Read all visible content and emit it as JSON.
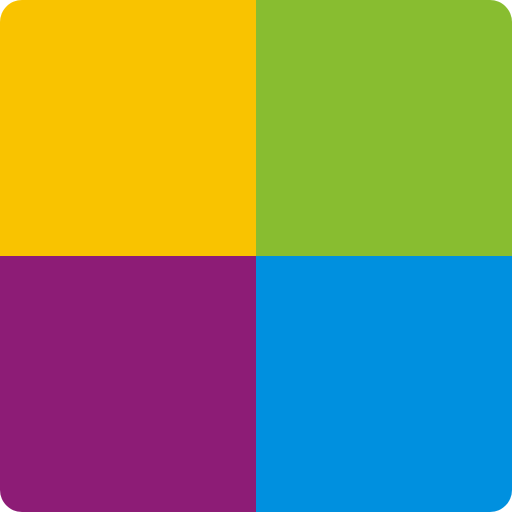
{
  "icon": {
    "quadrants": [
      {
        "id": "top-left",
        "color": "#F9C300"
      },
      {
        "id": "top-right",
        "color": "#88BD30"
      },
      {
        "id": "bottom-left",
        "color": "#8D1C76"
      },
      {
        "id": "bottom-right",
        "color": "#0090DF"
      }
    ]
  }
}
